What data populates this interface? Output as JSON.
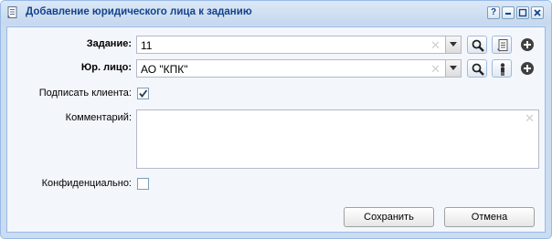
{
  "window": {
    "title": "Добавление юридического лица к заданию",
    "icons": [
      "document-icon",
      "help-icon",
      "minimize-icon",
      "maximize-icon",
      "close-icon"
    ],
    "tools": {
      "help": "?"
    }
  },
  "form": {
    "task": {
      "label": "Задание:",
      "value": "11"
    },
    "legal_entity": {
      "label": "Юр. лицо:",
      "value": "АО \"КПК\""
    },
    "sign_client": {
      "label": "Подписать клиента:",
      "checked": true
    },
    "comment": {
      "label": "Комментарий:",
      "value": ""
    },
    "confidential": {
      "label": "Конфиденциально:",
      "checked": false
    }
  },
  "buttons": {
    "save": "Сохранить",
    "cancel": "Отмена"
  },
  "colors": {
    "title_text": "#15428b",
    "window_border": "#99bbe8",
    "body_bg": "#f3f6fb"
  }
}
